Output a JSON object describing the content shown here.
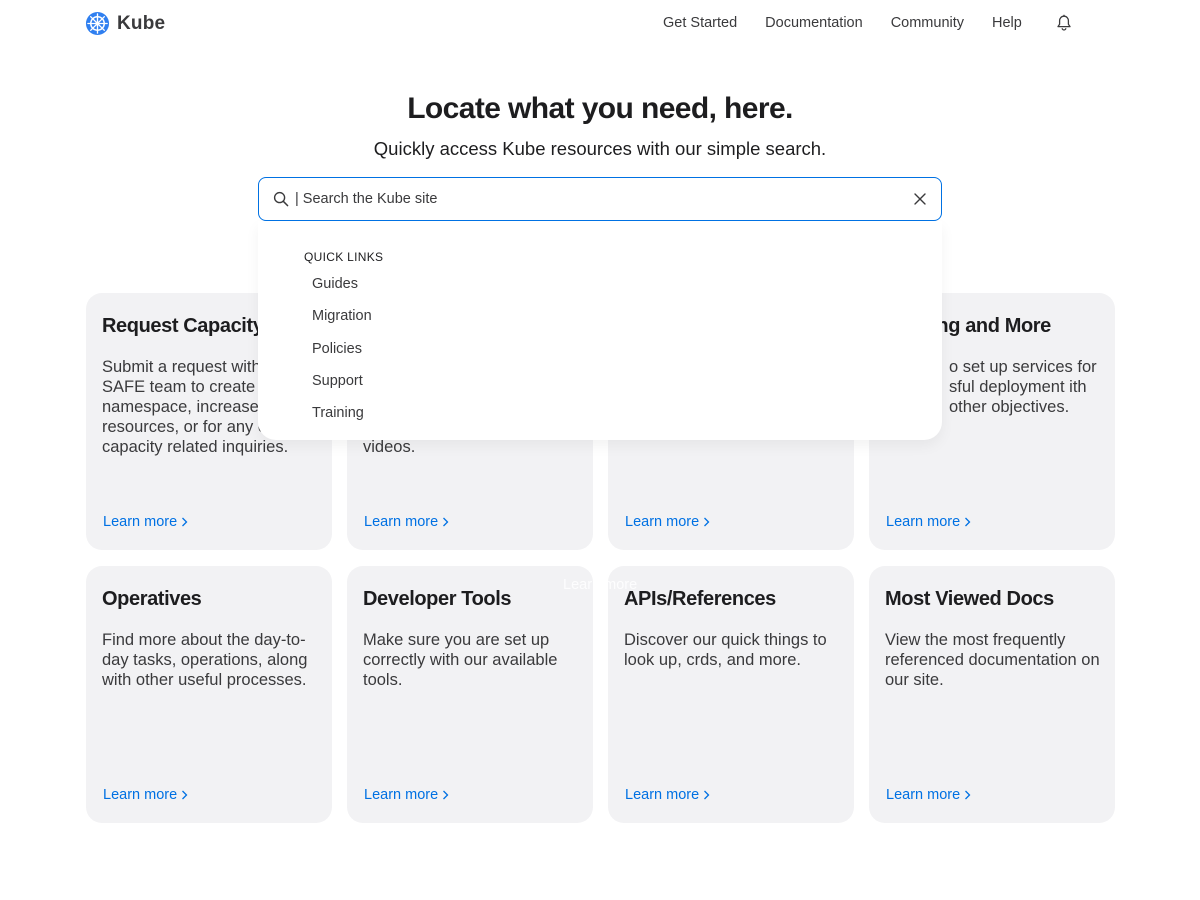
{
  "header": {
    "brand": "Kube",
    "nav": [
      "Get Started",
      "Documentation",
      "Community",
      "Help"
    ]
  },
  "hero": {
    "title": "Locate what you need, here.",
    "subtitle": "Quickly access Kube resources with our simple search."
  },
  "search": {
    "value": "| Search the Kube site",
    "quick_links_title": "QUICK LINKS",
    "quick_links": [
      "Guides",
      "Migration",
      "Policies",
      "Support",
      "Training"
    ]
  },
  "cards": [
    {
      "title": "Request Capacity",
      "desc": "Submit a request with the SAFE team to create a namespace, increase resources, or for any other capacity related inquiries.",
      "link": "Learn more"
    },
    {
      "title": "",
      "desc": "videos.",
      "link": "Learn more"
    },
    {
      "title": "",
      "desc": "",
      "link": "Learn more"
    },
    {
      "title": "ting and More",
      "desc": "o set up services for sful deployment ith other objectives.",
      "link": "Learn more"
    },
    {
      "title": "Operatives",
      "desc": "Find more about the day-to-day tasks, operations, along with other useful processes.",
      "link": "Learn more"
    },
    {
      "title": "Developer Tools",
      "desc": "Make sure you are set up correctly with our available tools.",
      "link": "Learn more"
    },
    {
      "title": "APIs/References",
      "desc": "Discover our quick things to look up, crds, and more.",
      "link": "Learn more"
    },
    {
      "title": "Most Viewed Docs",
      "desc": "View the most frequently referenced documentation on our site.",
      "link": "Learn more"
    }
  ],
  "overlay_link": "Learn more",
  "colors": {
    "accent": "#0071e3",
    "card_bg": "#f2f2f4",
    "logo": "#2f7ff0"
  },
  "icons": {
    "logo": "kube-logo-icon",
    "bell": "bell-icon",
    "search": "search-icon",
    "clear": "close-icon",
    "chevron": "chevron-right-icon"
  }
}
